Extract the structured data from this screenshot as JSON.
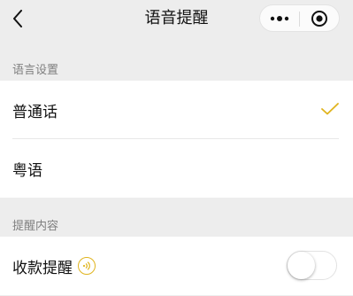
{
  "nav": {
    "title": "语音提醒",
    "back_icon": "back-chevron-icon",
    "more_icon": "more-dots-icon",
    "close_icon": "target-close-icon"
  },
  "language_section": {
    "header": "语言设置",
    "options": [
      {
        "label": "普通话",
        "selected": true
      },
      {
        "label": "粤语",
        "selected": false
      }
    ]
  },
  "reminder_section": {
    "header": "提醒内容",
    "items": [
      {
        "label": "收款提醒",
        "icon": "sound-wave-icon",
        "enabled": false
      }
    ]
  },
  "colors": {
    "accent": "#e0b41e",
    "background": "#ededed",
    "cell": "#ffffff"
  }
}
